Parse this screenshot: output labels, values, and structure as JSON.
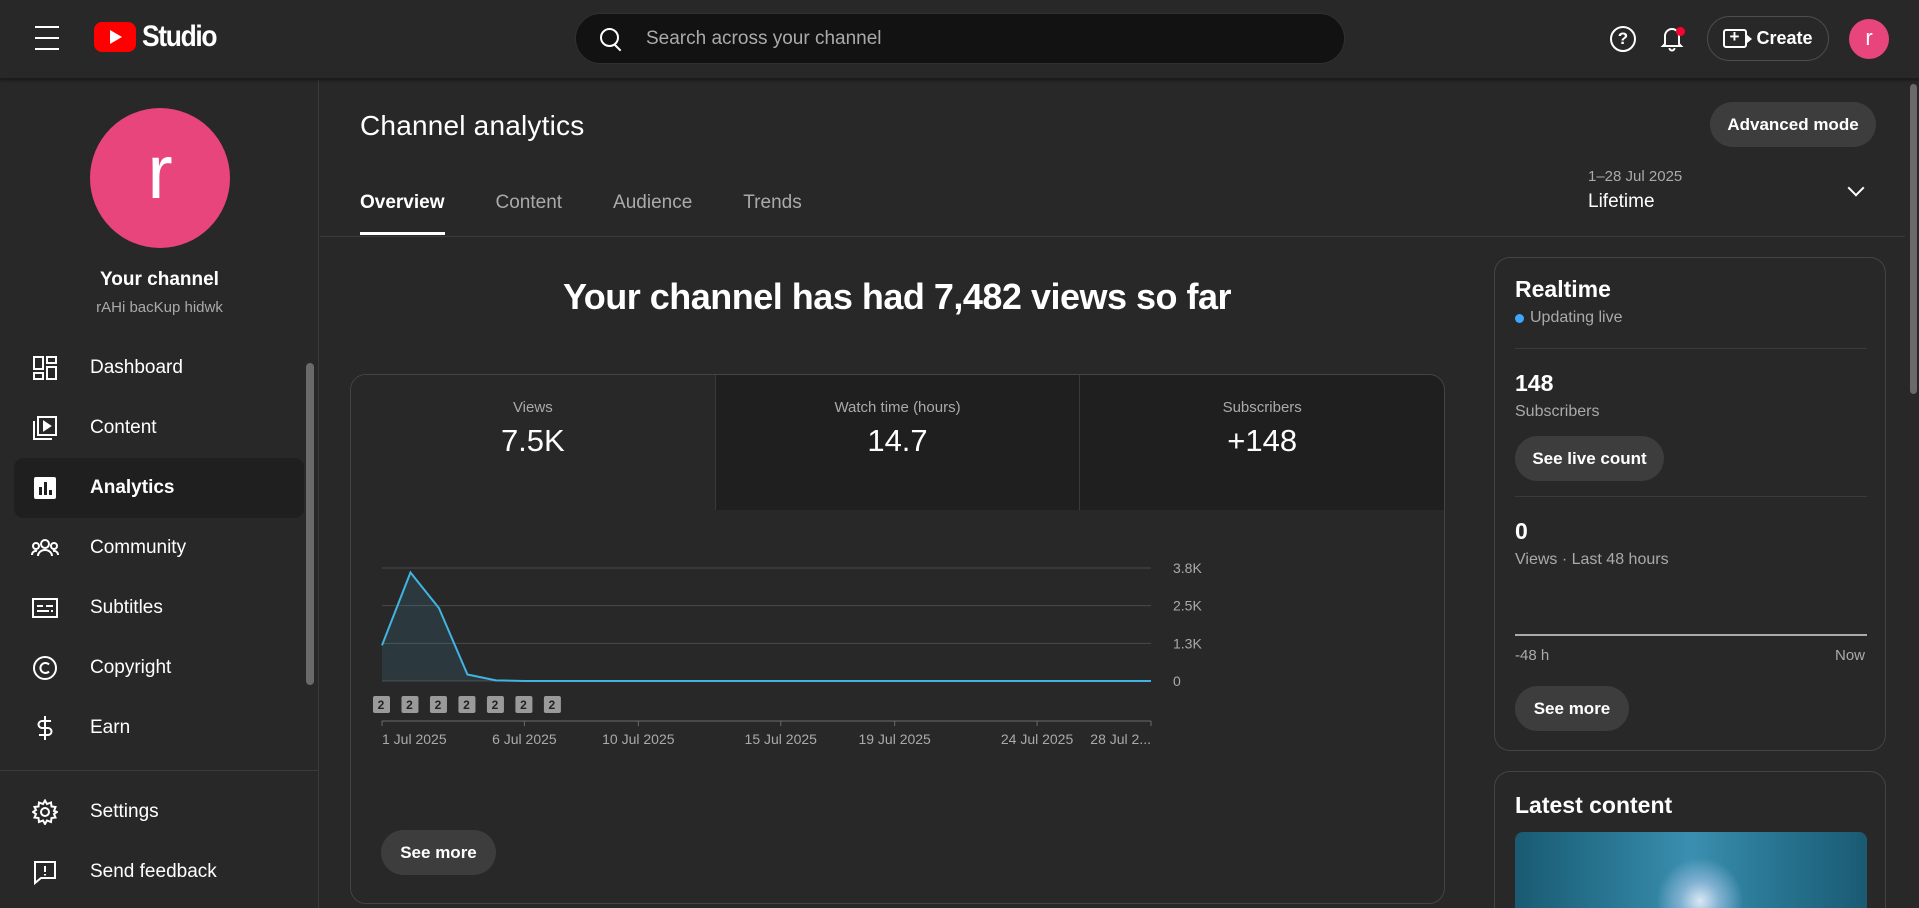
{
  "header": {
    "logo_text": "Studio",
    "search_placeholder": "Search across your channel",
    "create_label": "Create",
    "avatar_letter": "r",
    "help_glyph": "?"
  },
  "sidebar": {
    "avatar_letter": "r",
    "channel_title": "Your channel",
    "channel_handle": "rAHi bacKup hidwk",
    "items": [
      {
        "label": "Dashboard",
        "icon": "dashboard-icon"
      },
      {
        "label": "Content",
        "icon": "content-icon"
      },
      {
        "label": "Analytics",
        "icon": "analytics-icon",
        "active": true
      },
      {
        "label": "Community",
        "icon": "community-icon"
      },
      {
        "label": "Subtitles",
        "icon": "subtitles-icon"
      },
      {
        "label": "Copyright",
        "icon": "copyright-icon"
      },
      {
        "label": "Earn",
        "icon": "earn-icon"
      }
    ],
    "bottom_items": [
      {
        "label": "Settings",
        "icon": "gear-icon"
      },
      {
        "label": "Send feedback",
        "icon": "feedback-icon"
      }
    ]
  },
  "main": {
    "title": "Channel analytics",
    "advanced_mode_label": "Advanced mode",
    "tabs": [
      {
        "label": "Overview",
        "active": true
      },
      {
        "label": "Content"
      },
      {
        "label": "Audience"
      },
      {
        "label": "Trends"
      }
    ],
    "date_range": "1–28 Jul 2025",
    "date_value": "Lifetime",
    "headline": "Your channel has had 7,482 views so far",
    "metrics": [
      {
        "label": "Views",
        "value": "7.5K"
      },
      {
        "label": "Watch time (hours)",
        "value": "14.7"
      },
      {
        "label": "Subscribers",
        "value": "+148"
      }
    ],
    "see_more_label": "See more"
  },
  "chart_data": {
    "type": "area",
    "x": [
      "1 Jul 2025",
      "2 Jul",
      "3 Jul",
      "4 Jul",
      "5 Jul",
      "6 Jul",
      "7 Jul",
      "8 Jul",
      "9 Jul",
      "10 Jul",
      "11 Jul",
      "12 Jul",
      "13 Jul",
      "14 Jul",
      "15 Jul",
      "16 Jul",
      "17 Jul",
      "18 Jul",
      "19 Jul",
      "20 Jul",
      "21 Jul",
      "22 Jul",
      "23 Jul",
      "24 Jul",
      "25 Jul",
      "26 Jul",
      "27 Jul",
      "28 Jul"
    ],
    "series": [
      {
        "values": [
          1200,
          3650,
          2450,
          220,
          20,
          0,
          0,
          0,
          0,
          0,
          0,
          0,
          0,
          0,
          0,
          0,
          0,
          0,
          0,
          0,
          0,
          0,
          0,
          0,
          0,
          0,
          0,
          0
        ]
      }
    ],
    "ylim": [
      0,
      3800
    ],
    "yticks": [
      "3.8K",
      "2.5K",
      "1.3K",
      "0"
    ],
    "xtick_labels": [
      {
        "index": 0,
        "label": "1 Jul 2025"
      },
      {
        "index": 5,
        "label": "6 Jul 2025"
      },
      {
        "index": 9,
        "label": "10 Jul 2025"
      },
      {
        "index": 14,
        "label": "15 Jul 2025"
      },
      {
        "index": 18,
        "label": "19 Jul 2025"
      },
      {
        "index": 23,
        "label": "24 Jul 2025"
      },
      {
        "index": 27,
        "label": "28 Jul 2..."
      }
    ],
    "markers": [
      {
        "index": 0,
        "label": "2"
      },
      {
        "index": 1,
        "label": "2"
      },
      {
        "index": 2,
        "label": "2"
      },
      {
        "index": 3,
        "label": "2"
      },
      {
        "index": 4,
        "label": "2"
      },
      {
        "index": 5,
        "label": "2"
      },
      {
        "index": 6,
        "label": "2"
      }
    ],
    "line_color": "#41b4e1",
    "grid": true
  },
  "realtime": {
    "title": "Realtime",
    "status": "Updating live",
    "subscribers_value": "148",
    "subscribers_label": "Subscribers",
    "see_live_count_label": "See live count",
    "views_value": "0",
    "views_label": "Views · Last 48 hours",
    "axis_left": "-48 h",
    "axis_right": "Now",
    "see_more_label": "See more"
  },
  "latest_content": {
    "title": "Latest content"
  }
}
